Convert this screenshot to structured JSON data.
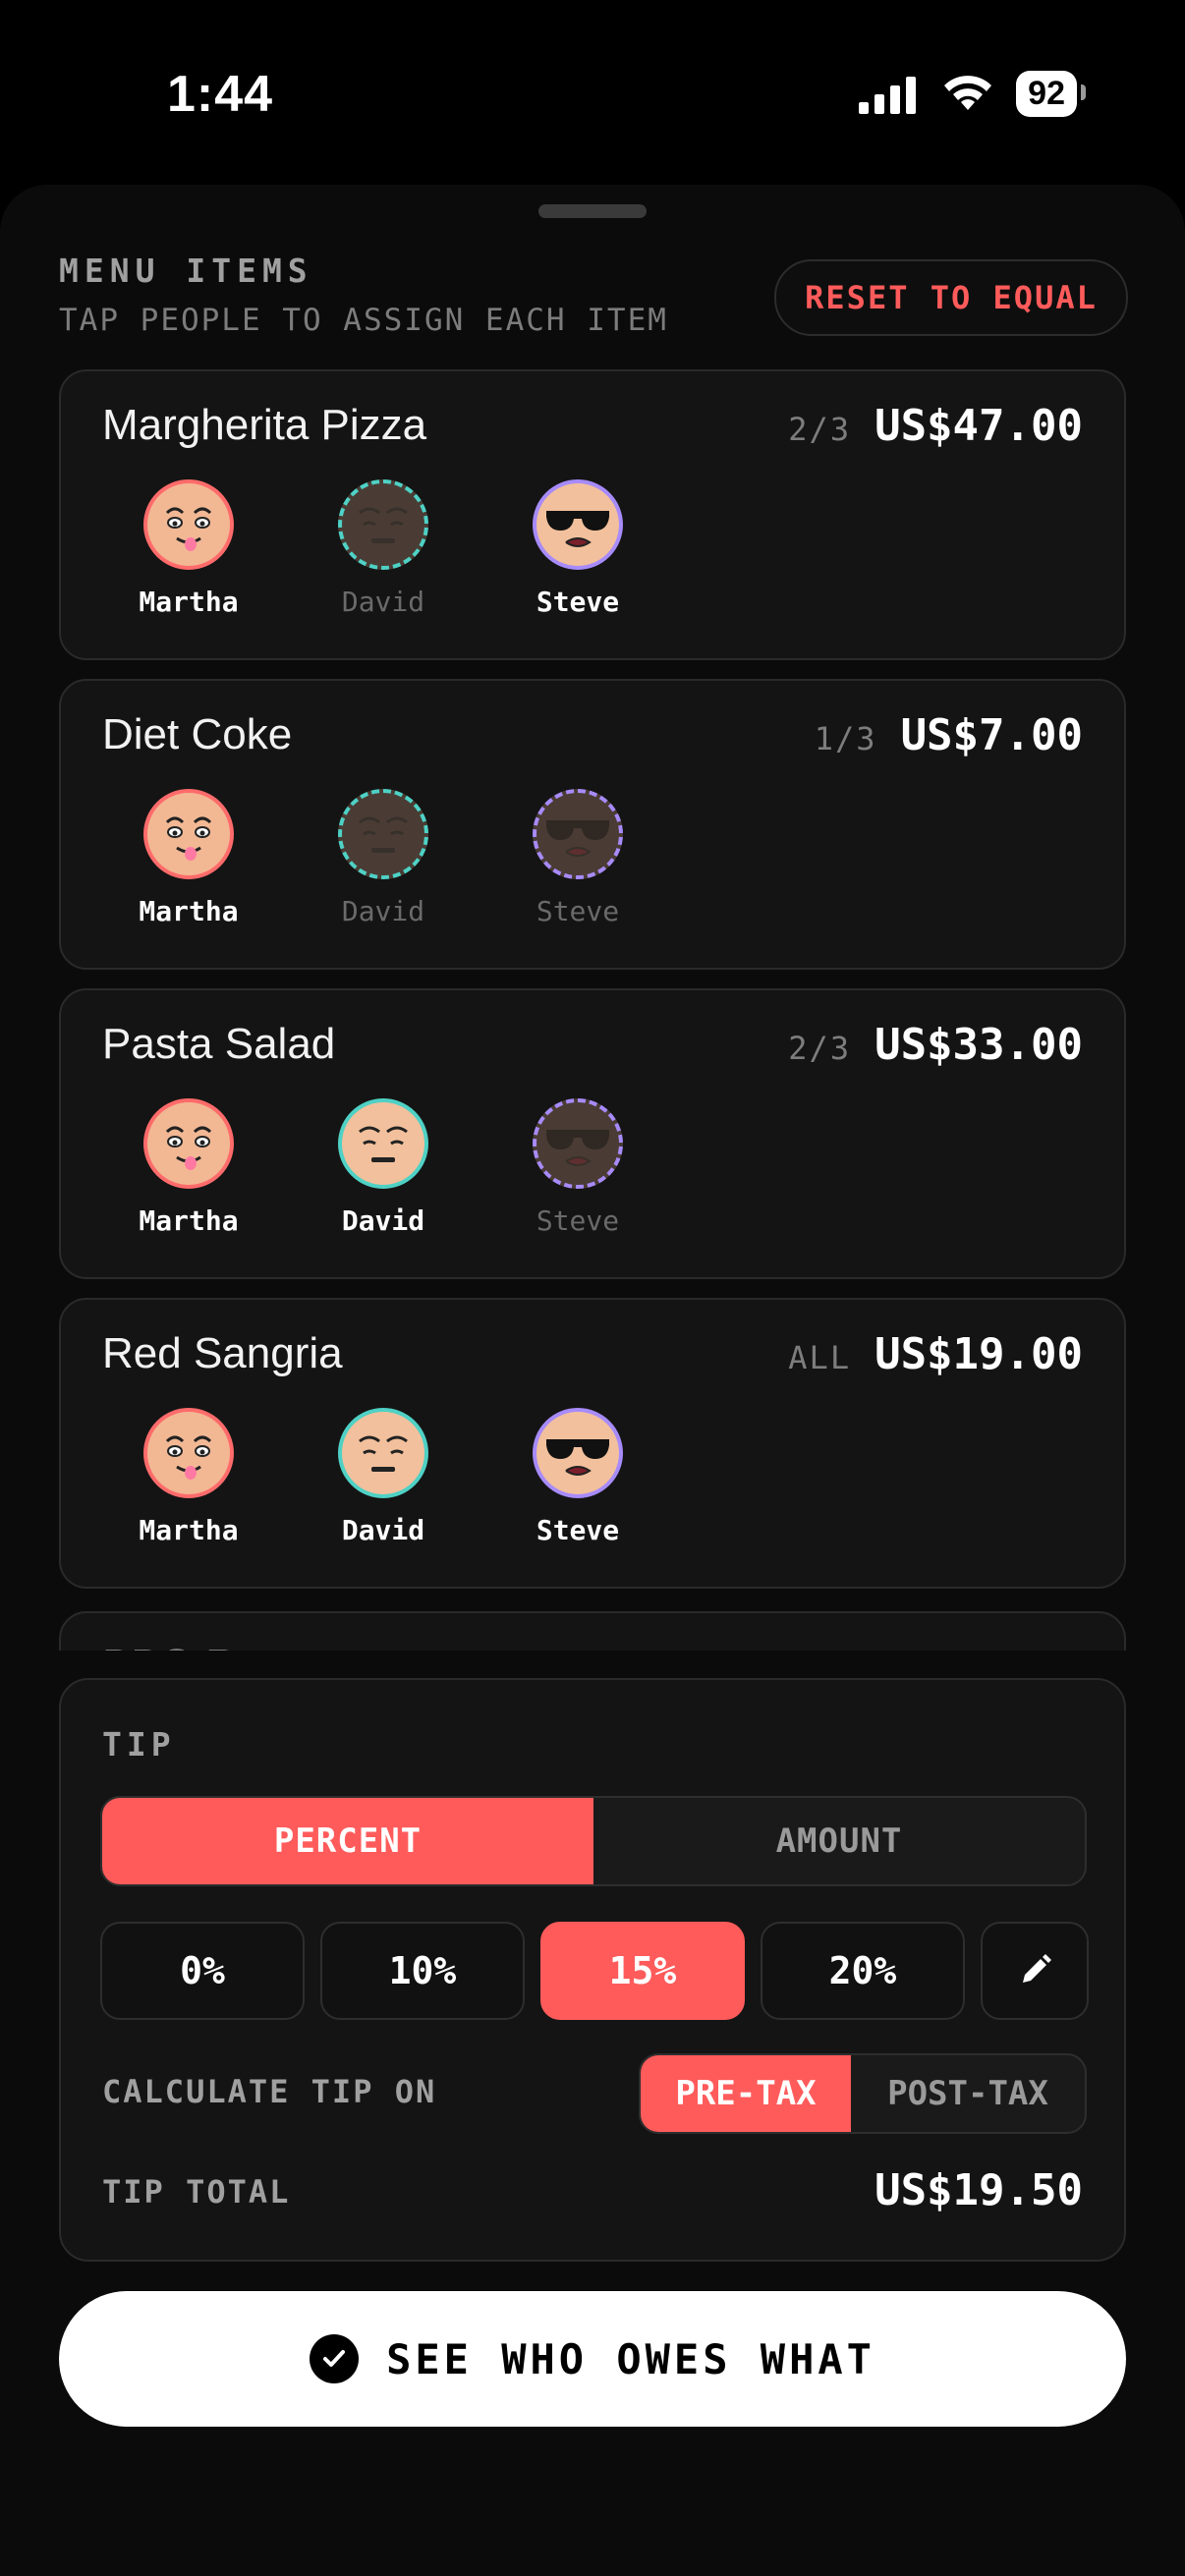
{
  "status": {
    "time": "1:44",
    "battery": "92"
  },
  "header": {
    "title": "MENU ITEMS",
    "subtitle": "TAP PEOPLE TO ASSIGN EACH ITEM",
    "reset_label": "RESET TO EQUAL"
  },
  "items": [
    {
      "name": "Margherita Pizza",
      "count": "2/3",
      "price": "US$47.00",
      "people": [
        {
          "name": "Martha",
          "on": true
        },
        {
          "name": "David",
          "on": false
        },
        {
          "name": "Steve",
          "on": true
        }
      ]
    },
    {
      "name": "Diet Coke",
      "count": "1/3",
      "price": "US$7.00",
      "people": [
        {
          "name": "Martha",
          "on": true
        },
        {
          "name": "David",
          "on": false
        },
        {
          "name": "Steve",
          "on": false
        }
      ]
    },
    {
      "name": "Pasta Salad",
      "count": "2/3",
      "price": "US$33.00",
      "people": [
        {
          "name": "Martha",
          "on": true
        },
        {
          "name": "David",
          "on": true
        },
        {
          "name": "Steve",
          "on": false
        }
      ]
    },
    {
      "name": "Red Sangria",
      "count": "ALL",
      "price": "US$19.00",
      "people": [
        {
          "name": "Martha",
          "on": true
        },
        {
          "name": "David",
          "on": true
        },
        {
          "name": "Steve",
          "on": true
        }
      ]
    }
  ],
  "partial_item": {
    "name": "BBQ R"
  },
  "tip": {
    "title": "TIP",
    "mode_percent": "PERCENT",
    "mode_amount": "AMOUNT",
    "presets": [
      "0%",
      "10%",
      "15%",
      "20%"
    ],
    "selected_preset": "15%",
    "edit_icon": "pencil-icon",
    "calc_label": "CALCULATE TIP ON",
    "pre_tax": "PRE-TAX",
    "post_tax": "POST-TAX",
    "total_label": "TIP TOTAL",
    "total_value": "US$19.50"
  },
  "cta": {
    "label": "SEE WHO OWES WHAT",
    "icon": "check-circle-icon"
  },
  "colors": {
    "accent": "#ff5b5b",
    "martha": "#ff6b6b",
    "david": "#4fd1c5",
    "steve": "#a78bfa"
  }
}
